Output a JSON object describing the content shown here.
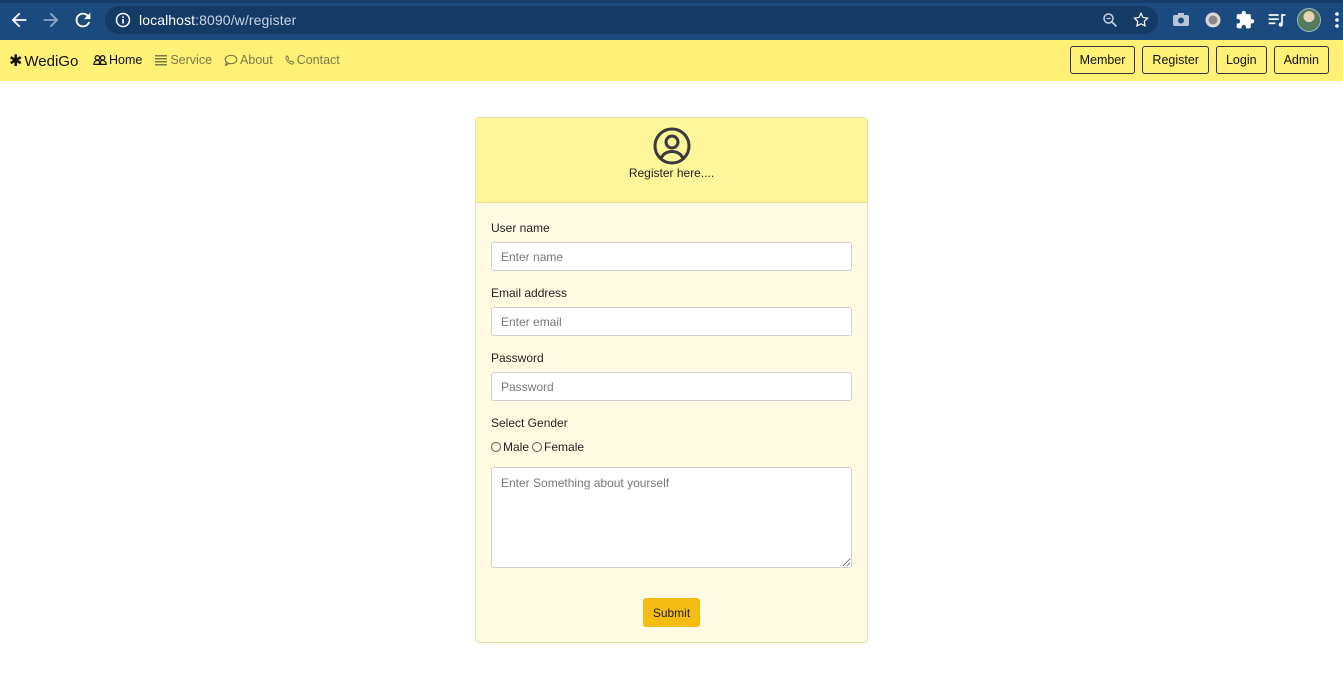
{
  "browser": {
    "url_host": "localhost",
    "url_path": ":8090/w/register"
  },
  "navbar": {
    "brand": "WediGo",
    "links": [
      {
        "label": "Home",
        "icon": "people-icon",
        "active": true
      },
      {
        "label": "Service",
        "icon": "list-icon",
        "active": false
      },
      {
        "label": "About",
        "icon": "chat-icon",
        "active": false
      },
      {
        "label": "Contact",
        "icon": "phone-icon",
        "active": false
      }
    ],
    "buttons": [
      "Member",
      "Register",
      "Login",
      "Admin"
    ],
    "bg_color": "#fff176"
  },
  "form": {
    "title": "Register here....",
    "username_label": "User name",
    "username_placeholder": "Enter name",
    "email_label": "Email address",
    "email_placeholder": "Enter email",
    "password_label": "Password",
    "password_placeholder": "Password",
    "gender_label": "Select Gender",
    "gender_options": [
      "Male",
      "Female"
    ],
    "about_placeholder": "Enter Something about yourself",
    "submit_label": "Submit",
    "submit_color": "#f5bd14"
  }
}
